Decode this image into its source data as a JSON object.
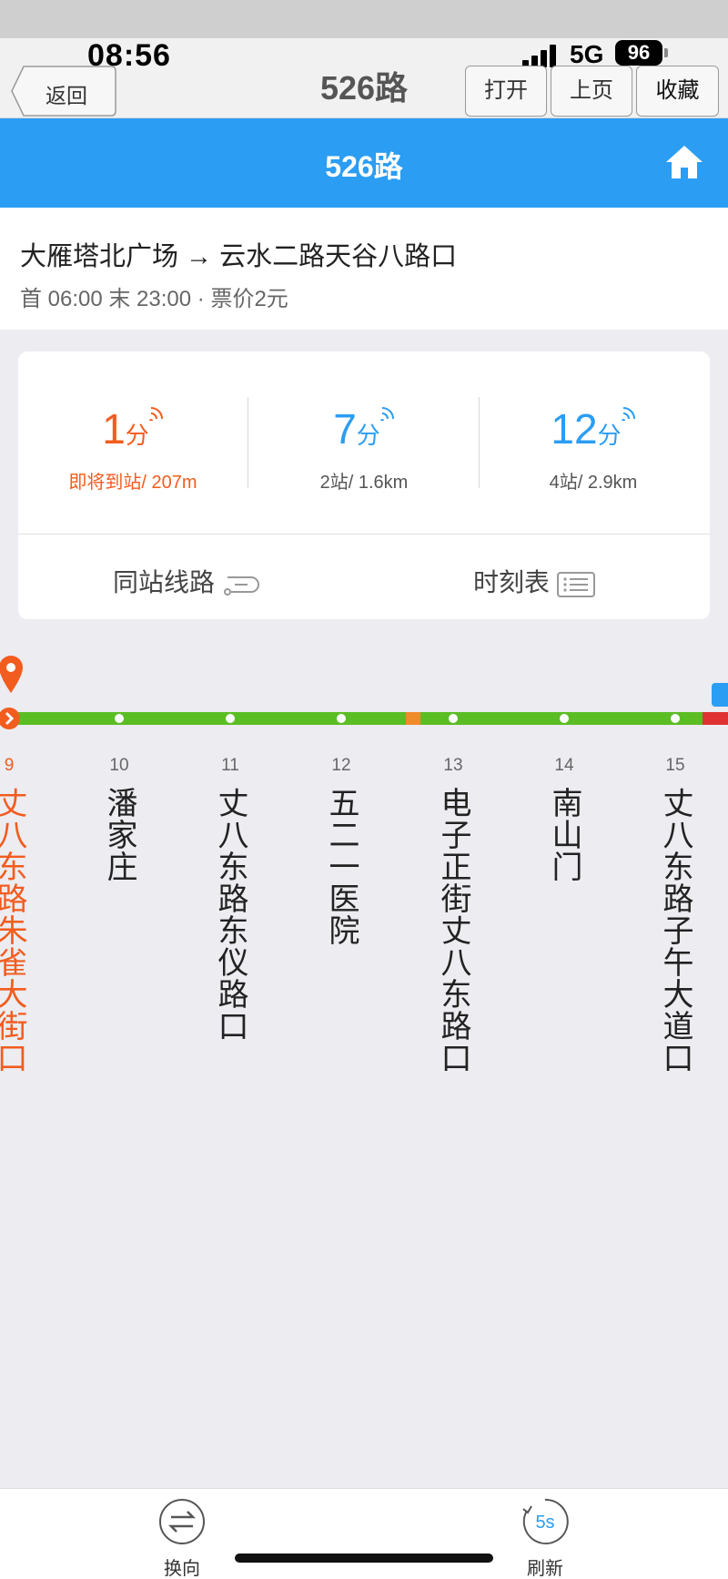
{
  "status_bar": {
    "time": "08:56",
    "network": "5G",
    "battery": "96"
  },
  "navbar": {
    "back_label": "返回",
    "title": "526路",
    "open_label": "打开",
    "prev_label": "上页",
    "favorite_label": "收藏"
  },
  "header": {
    "title": "526路"
  },
  "route": {
    "direction": "大雁塔北广场 → 云水二路天谷八路口",
    "schedule": "首 06:00 末 23:00 · 票价2元"
  },
  "arrivals": [
    {
      "minutes": "1",
      "unit": "分",
      "detail": "即将到站/ 207m"
    },
    {
      "minutes": "7",
      "unit": "分",
      "detail": "2站/ 1.6km"
    },
    {
      "minutes": "12",
      "unit": "分",
      "detail": "4站/ 2.9km"
    }
  ],
  "card_actions": {
    "same_stop_lines": "同站线路",
    "timetable": "时刻表"
  },
  "stops": [
    {
      "num": "9",
      "name": "丈八东路朱雀大街口"
    },
    {
      "num": "10",
      "name": "潘家庄"
    },
    {
      "num": "11",
      "name": "丈八东路东仪路口"
    },
    {
      "num": "12",
      "name": "五二一医院"
    },
    {
      "num": "13",
      "name": "电子正街丈八东路口"
    },
    {
      "num": "14",
      "name": "南山门"
    },
    {
      "num": "15",
      "name": "丈八东路子午大道口"
    }
  ],
  "bottom_bar": {
    "switch_label": "换向",
    "refresh_label": "刷新",
    "refresh_interval": "5s"
  },
  "colors": {
    "accent": "#2b9df3",
    "highlight": "#f25c1e",
    "line": "#5bbd24",
    "congested": "#e03232"
  }
}
